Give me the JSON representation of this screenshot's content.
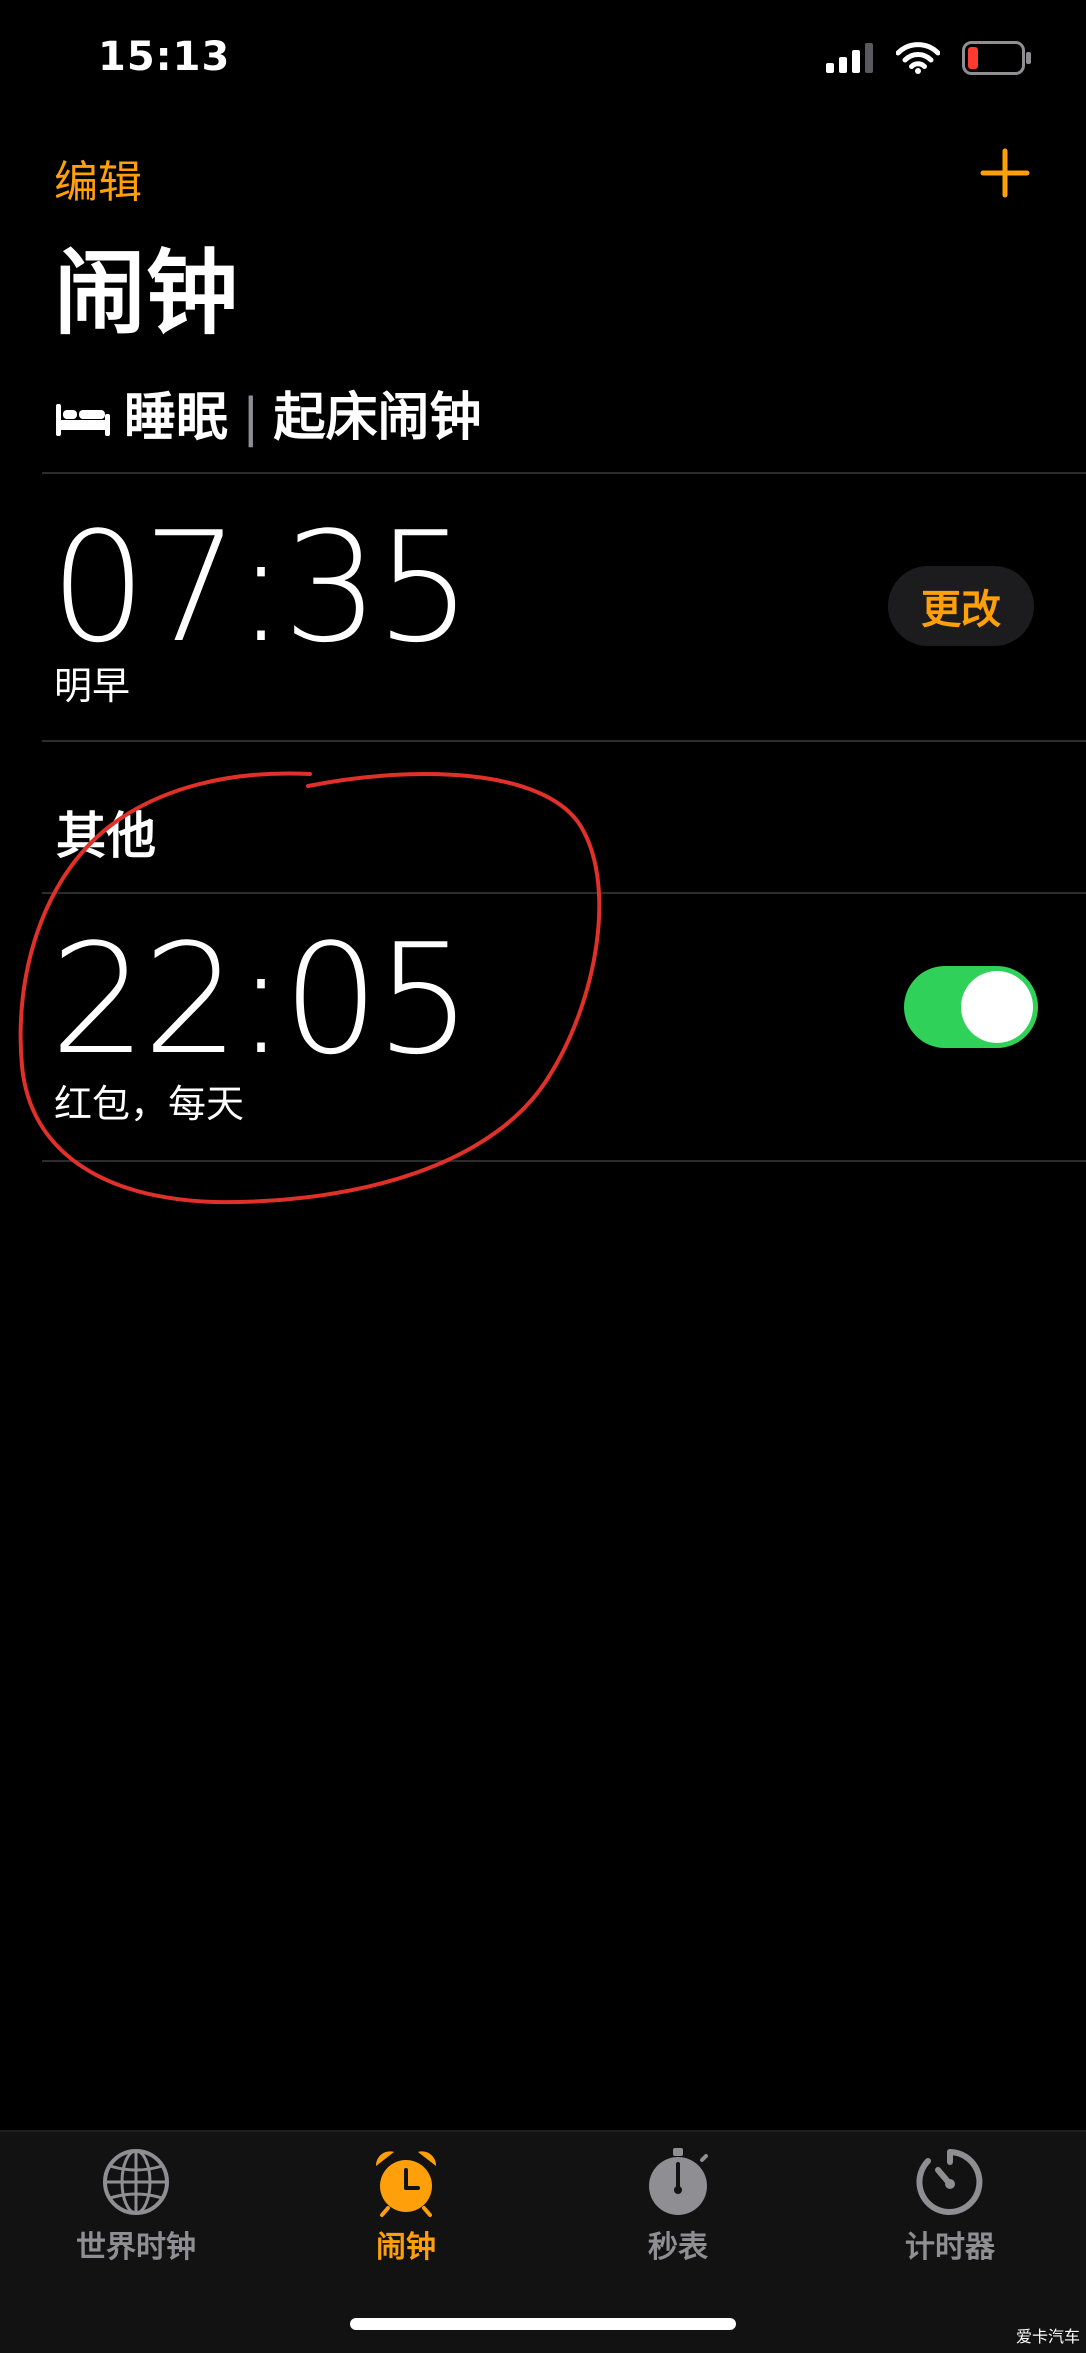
{
  "status_bar": {
    "time": "15:13",
    "icons": [
      "cellular-signal-icon",
      "wifi-icon",
      "battery-low-icon"
    ],
    "battery_color": "#ff3b30"
  },
  "nav": {
    "edit_label": "编辑",
    "add_icon": "plus-icon"
  },
  "page_title": "闹钟",
  "sleep_section": {
    "icon": "bed-icon",
    "title": "睡眠",
    "separator": "|",
    "subtitle": "起床闹钟",
    "alarm": {
      "time": "07:35",
      "label": "明早",
      "change_label": "更改"
    }
  },
  "other_section": {
    "title": "其他",
    "alarms": [
      {
        "time": "22:05",
        "label": "红包，每天",
        "enabled": true
      }
    ]
  },
  "tab_bar": {
    "tabs": [
      {
        "label": "世界时钟",
        "icon": "globe-icon",
        "active": false
      },
      {
        "label": "闹钟",
        "icon": "alarm-clock-icon",
        "active": true
      },
      {
        "label": "秒表",
        "icon": "stopwatch-icon",
        "active": false
      },
      {
        "label": "计时器",
        "icon": "timer-icon",
        "active": false
      }
    ]
  },
  "watermark": "爱卡汽车",
  "colors": {
    "accent": "#ff9f0a",
    "toggle_on": "#30d158",
    "annotation": "#e0302a",
    "background": "#000000"
  }
}
